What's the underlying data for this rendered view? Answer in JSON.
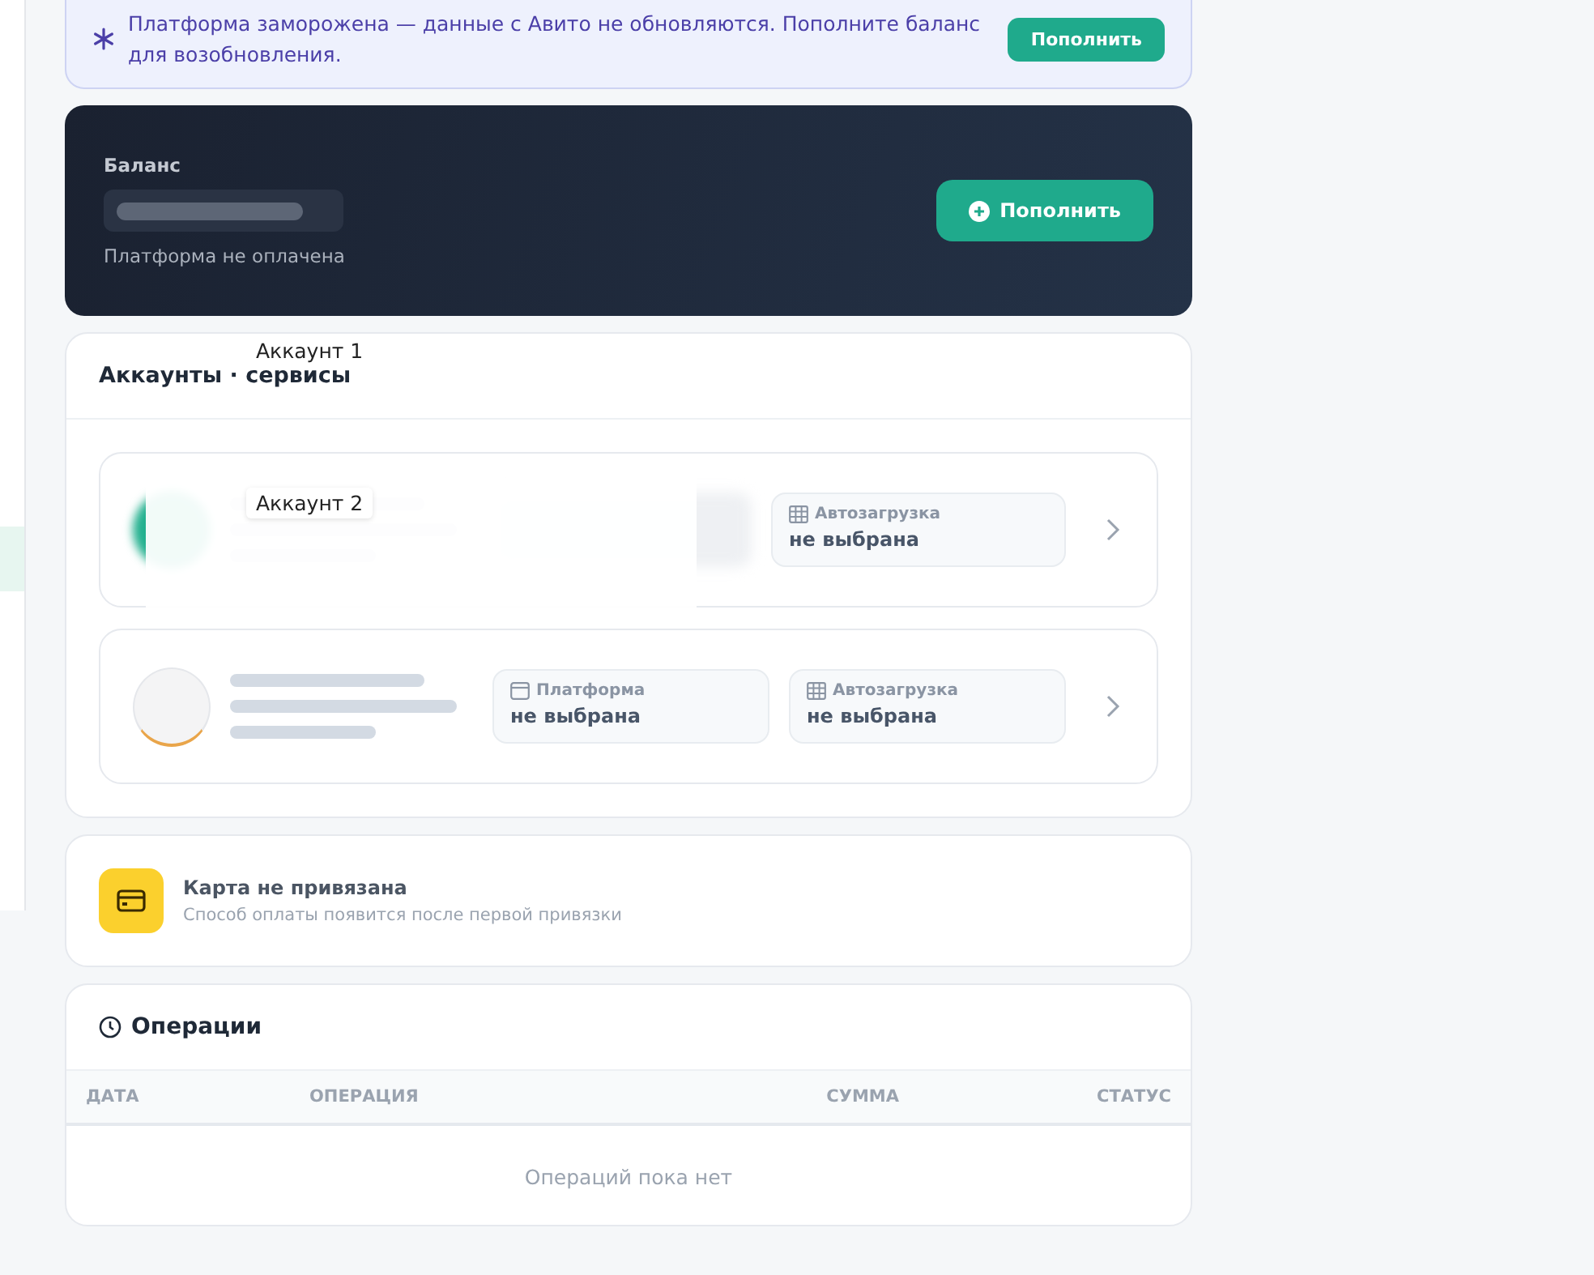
{
  "banner": {
    "text": "Платформа заморожена — данные с Авито не обновляются. Пополните баланс для возобновления.",
    "button": "Пополнить"
  },
  "balance": {
    "label": "Баланс",
    "status": "Платформа не оплачена",
    "button": "Пополнить"
  },
  "accounts": {
    "title": "Аккаунты · сервисы",
    "rows": [
      {
        "kind": "filled",
        "chips": [
          {
            "kind": "blurred"
          },
          {
            "kind": "autoload",
            "label": "Автозагрузка",
            "value": "не выбрана"
          }
        ]
      },
      {
        "kind": "empty",
        "chips": [
          {
            "kind": "platform",
            "label": "Платформа",
            "value": "не выбрана"
          },
          {
            "kind": "autoload",
            "label": "Автозагрузка",
            "value": "не выбрана"
          }
        ]
      }
    ]
  },
  "overlays": [
    {
      "kind": "plain",
      "text": "Аккаунт 1"
    },
    {
      "kind": "boxed",
      "text": "Аккаунт 2"
    }
  ],
  "payment": {
    "title": "Карта не привязана",
    "subtitle": "Способ оплаты появится после первой привязки"
  },
  "operations": {
    "title": "Операции",
    "columns": [
      "ДАТА",
      "ОПЕРАЦИЯ",
      "СУММА",
      "СТАТУС"
    ],
    "empty": "Операций пока нет"
  }
}
